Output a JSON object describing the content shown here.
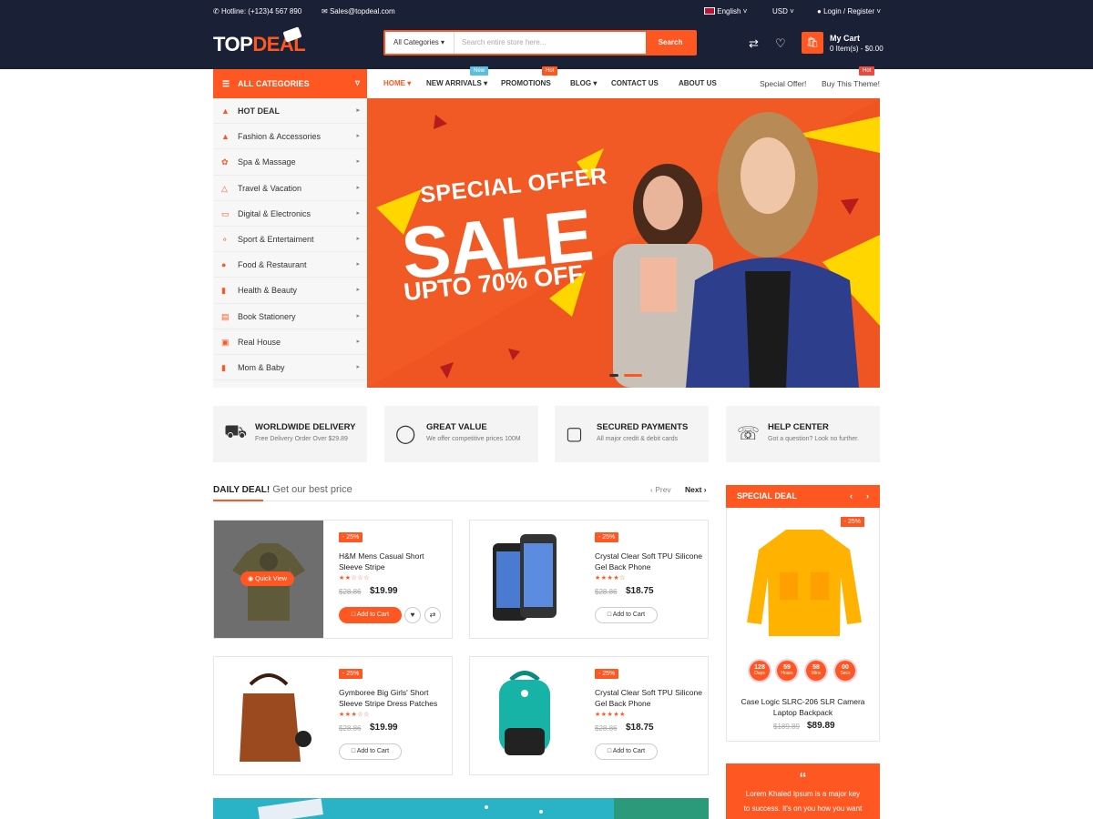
{
  "topbar": {
    "hotline": "Hotline: (+123)4 567 890",
    "email": "Sales@topdeal.com",
    "language": "English",
    "currency": "USD",
    "account": "Login / Register"
  },
  "brand": {
    "logo_a": "TOP",
    "logo_b": "DEAL"
  },
  "search": {
    "category": "All Categories",
    "placeholder": "Search entire store here...",
    "button": "Search"
  },
  "cart": {
    "title": "My Cart",
    "summary": "0 Item(s) - $0.00"
  },
  "categories": {
    "heading": "ALL CATEGORIES",
    "items": [
      {
        "label": "HOT DEAL",
        "icon": "flame-icon"
      },
      {
        "label": "Fashion & Accessories",
        "icon": "shirt-icon"
      },
      {
        "label": "Spa & Massage",
        "icon": "lotus-icon"
      },
      {
        "label": "Travel & Vacation",
        "icon": "walking-icon"
      },
      {
        "label": "Digital & Electronics",
        "icon": "laptop-icon"
      },
      {
        "label": "Sport & Entertaiment",
        "icon": "sport-icon"
      },
      {
        "label": "Food & Restaurant",
        "icon": "food-icon"
      },
      {
        "label": "Health & Beauty",
        "icon": "beauty-icon"
      },
      {
        "label": "Book Stationery",
        "icon": "book-icon"
      },
      {
        "label": "Real House",
        "icon": "house-icon"
      },
      {
        "label": "Mom & Baby",
        "icon": "bottle-icon"
      }
    ]
  },
  "nav": {
    "home": "HOME",
    "new_arrivals": "NEW ARRIVALS",
    "promotions": "PROMOTIONS",
    "blog": "BLOG",
    "contact": "CONTACT US",
    "about": "ABOUT US",
    "special_offer": "Special Offer!",
    "buy_theme": "Buy This Theme!",
    "badge_new": "New",
    "badge_hot": "Hot",
    "badge_hot2": "Hot"
  },
  "banner": {
    "line1": "SPECIAL OFFER",
    "line2": "SALE",
    "line3": "UPTO 70% OFF"
  },
  "features": [
    {
      "title": "WORLDWIDE DELIVERY",
      "sub": "Free Delivery Order Over $29.89",
      "icon": "truck-icon"
    },
    {
      "title": "GREAT VALUE",
      "sub": "We offer competitive prices 100M",
      "icon": "money-hand-icon"
    },
    {
      "title": "SECURED PAYMENTS",
      "sub": "All major credit & debit cards",
      "icon": "lock-icon"
    },
    {
      "title": "HELP CENTER",
      "sub": "Got a question? Look no further.",
      "icon": "headset-icon"
    }
  ],
  "daily_deal": {
    "title_bold": "DAILY DEAL!",
    "title_rest": " Get our best price",
    "prev": "‹ Prev",
    "next": "Next ›"
  },
  "products": [
    {
      "discount": "- 25%",
      "name": "H&M Mens Casual Short Sleeve Stripe",
      "stars": "★★☆☆☆",
      "rating": 2,
      "old": "$28.86",
      "price": "$19.99",
      "cart": "Add to Cart",
      "quick": "Quick View"
    },
    {
      "discount": "- 25%",
      "name": "Crystal Clear Soft TPU Silicone Gel Back Phone",
      "stars": "★★★★☆",
      "rating": 4,
      "old": "$28.86",
      "price": "$18.75",
      "cart": "Add to Cart"
    },
    {
      "discount": "- 25%",
      "name": "Gymboree Big Girls' Short Sleeve Stripe Dress Patches",
      "stars": "★★★☆☆",
      "rating": 3,
      "old": "$28.86",
      "price": "$19.99",
      "cart": "Add to Cart"
    },
    {
      "discount": "- 25%",
      "name": "Crystal Clear Soft TPU Silicone Gel Back Phone",
      "stars": "★★★★★",
      "rating": 5,
      "old": "$28.86",
      "price": "$18.75",
      "cart": "Add to Cart"
    }
  ],
  "special_deal": {
    "heading": "SPECIAL DEAL",
    "discount": "- 25%",
    "countdown": [
      {
        "n": "128",
        "l": "Days"
      },
      {
        "n": "59",
        "l": "Hours"
      },
      {
        "n": "58",
        "l": "Mins"
      },
      {
        "n": "00",
        "l": "Secs"
      }
    ],
    "name": "Case Logic SLRC-206 SLR Camera Laptop Backpack",
    "old": "$189.89",
    "price": "$89.89"
  },
  "testimonial": {
    "quote_mark": "“",
    "text1": "Lorem Khaled Ipsum is a major key",
    "text2": "to success. It's on you how you want"
  },
  "colors": {
    "accent": "#ff5722",
    "dark": "#1a2035"
  }
}
